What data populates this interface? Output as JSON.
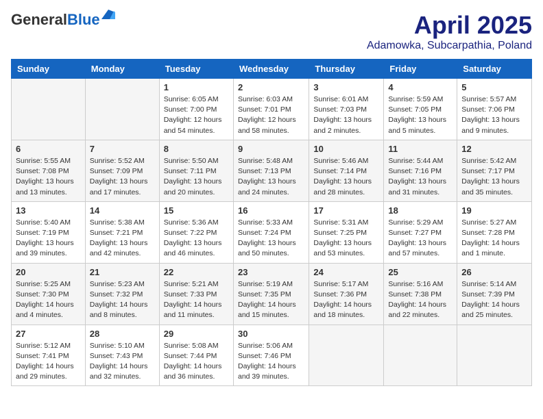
{
  "logo": {
    "general": "General",
    "blue": "Blue"
  },
  "header": {
    "month": "April 2025",
    "location": "Adamowka, Subcarpathia, Poland"
  },
  "weekdays": [
    "Sunday",
    "Monday",
    "Tuesday",
    "Wednesday",
    "Thursday",
    "Friday",
    "Saturday"
  ],
  "weeks": [
    [
      {
        "day": "",
        "info": ""
      },
      {
        "day": "",
        "info": ""
      },
      {
        "day": "1",
        "info": "Sunrise: 6:05 AM\nSunset: 7:00 PM\nDaylight: 12 hours\nand 54 minutes."
      },
      {
        "day": "2",
        "info": "Sunrise: 6:03 AM\nSunset: 7:01 PM\nDaylight: 12 hours\nand 58 minutes."
      },
      {
        "day": "3",
        "info": "Sunrise: 6:01 AM\nSunset: 7:03 PM\nDaylight: 13 hours\nand 2 minutes."
      },
      {
        "day": "4",
        "info": "Sunrise: 5:59 AM\nSunset: 7:05 PM\nDaylight: 13 hours\nand 5 minutes."
      },
      {
        "day": "5",
        "info": "Sunrise: 5:57 AM\nSunset: 7:06 PM\nDaylight: 13 hours\nand 9 minutes."
      }
    ],
    [
      {
        "day": "6",
        "info": "Sunrise: 5:55 AM\nSunset: 7:08 PM\nDaylight: 13 hours\nand 13 minutes."
      },
      {
        "day": "7",
        "info": "Sunrise: 5:52 AM\nSunset: 7:09 PM\nDaylight: 13 hours\nand 17 minutes."
      },
      {
        "day": "8",
        "info": "Sunrise: 5:50 AM\nSunset: 7:11 PM\nDaylight: 13 hours\nand 20 minutes."
      },
      {
        "day": "9",
        "info": "Sunrise: 5:48 AM\nSunset: 7:13 PM\nDaylight: 13 hours\nand 24 minutes."
      },
      {
        "day": "10",
        "info": "Sunrise: 5:46 AM\nSunset: 7:14 PM\nDaylight: 13 hours\nand 28 minutes."
      },
      {
        "day": "11",
        "info": "Sunrise: 5:44 AM\nSunset: 7:16 PM\nDaylight: 13 hours\nand 31 minutes."
      },
      {
        "day": "12",
        "info": "Sunrise: 5:42 AM\nSunset: 7:17 PM\nDaylight: 13 hours\nand 35 minutes."
      }
    ],
    [
      {
        "day": "13",
        "info": "Sunrise: 5:40 AM\nSunset: 7:19 PM\nDaylight: 13 hours\nand 39 minutes."
      },
      {
        "day": "14",
        "info": "Sunrise: 5:38 AM\nSunset: 7:21 PM\nDaylight: 13 hours\nand 42 minutes."
      },
      {
        "day": "15",
        "info": "Sunrise: 5:36 AM\nSunset: 7:22 PM\nDaylight: 13 hours\nand 46 minutes."
      },
      {
        "day": "16",
        "info": "Sunrise: 5:33 AM\nSunset: 7:24 PM\nDaylight: 13 hours\nand 50 minutes."
      },
      {
        "day": "17",
        "info": "Sunrise: 5:31 AM\nSunset: 7:25 PM\nDaylight: 13 hours\nand 53 minutes."
      },
      {
        "day": "18",
        "info": "Sunrise: 5:29 AM\nSunset: 7:27 PM\nDaylight: 13 hours\nand 57 minutes."
      },
      {
        "day": "19",
        "info": "Sunrise: 5:27 AM\nSunset: 7:28 PM\nDaylight: 14 hours\nand 1 minute."
      }
    ],
    [
      {
        "day": "20",
        "info": "Sunrise: 5:25 AM\nSunset: 7:30 PM\nDaylight: 14 hours\nand 4 minutes."
      },
      {
        "day": "21",
        "info": "Sunrise: 5:23 AM\nSunset: 7:32 PM\nDaylight: 14 hours\nand 8 minutes."
      },
      {
        "day": "22",
        "info": "Sunrise: 5:21 AM\nSunset: 7:33 PM\nDaylight: 14 hours\nand 11 minutes."
      },
      {
        "day": "23",
        "info": "Sunrise: 5:19 AM\nSunset: 7:35 PM\nDaylight: 14 hours\nand 15 minutes."
      },
      {
        "day": "24",
        "info": "Sunrise: 5:17 AM\nSunset: 7:36 PM\nDaylight: 14 hours\nand 18 minutes."
      },
      {
        "day": "25",
        "info": "Sunrise: 5:16 AM\nSunset: 7:38 PM\nDaylight: 14 hours\nand 22 minutes."
      },
      {
        "day": "26",
        "info": "Sunrise: 5:14 AM\nSunset: 7:39 PM\nDaylight: 14 hours\nand 25 minutes."
      }
    ],
    [
      {
        "day": "27",
        "info": "Sunrise: 5:12 AM\nSunset: 7:41 PM\nDaylight: 14 hours\nand 29 minutes."
      },
      {
        "day": "28",
        "info": "Sunrise: 5:10 AM\nSunset: 7:43 PM\nDaylight: 14 hours\nand 32 minutes."
      },
      {
        "day": "29",
        "info": "Sunrise: 5:08 AM\nSunset: 7:44 PM\nDaylight: 14 hours\nand 36 minutes."
      },
      {
        "day": "30",
        "info": "Sunrise: 5:06 AM\nSunset: 7:46 PM\nDaylight: 14 hours\nand 39 minutes."
      },
      {
        "day": "",
        "info": ""
      },
      {
        "day": "",
        "info": ""
      },
      {
        "day": "",
        "info": ""
      }
    ]
  ]
}
